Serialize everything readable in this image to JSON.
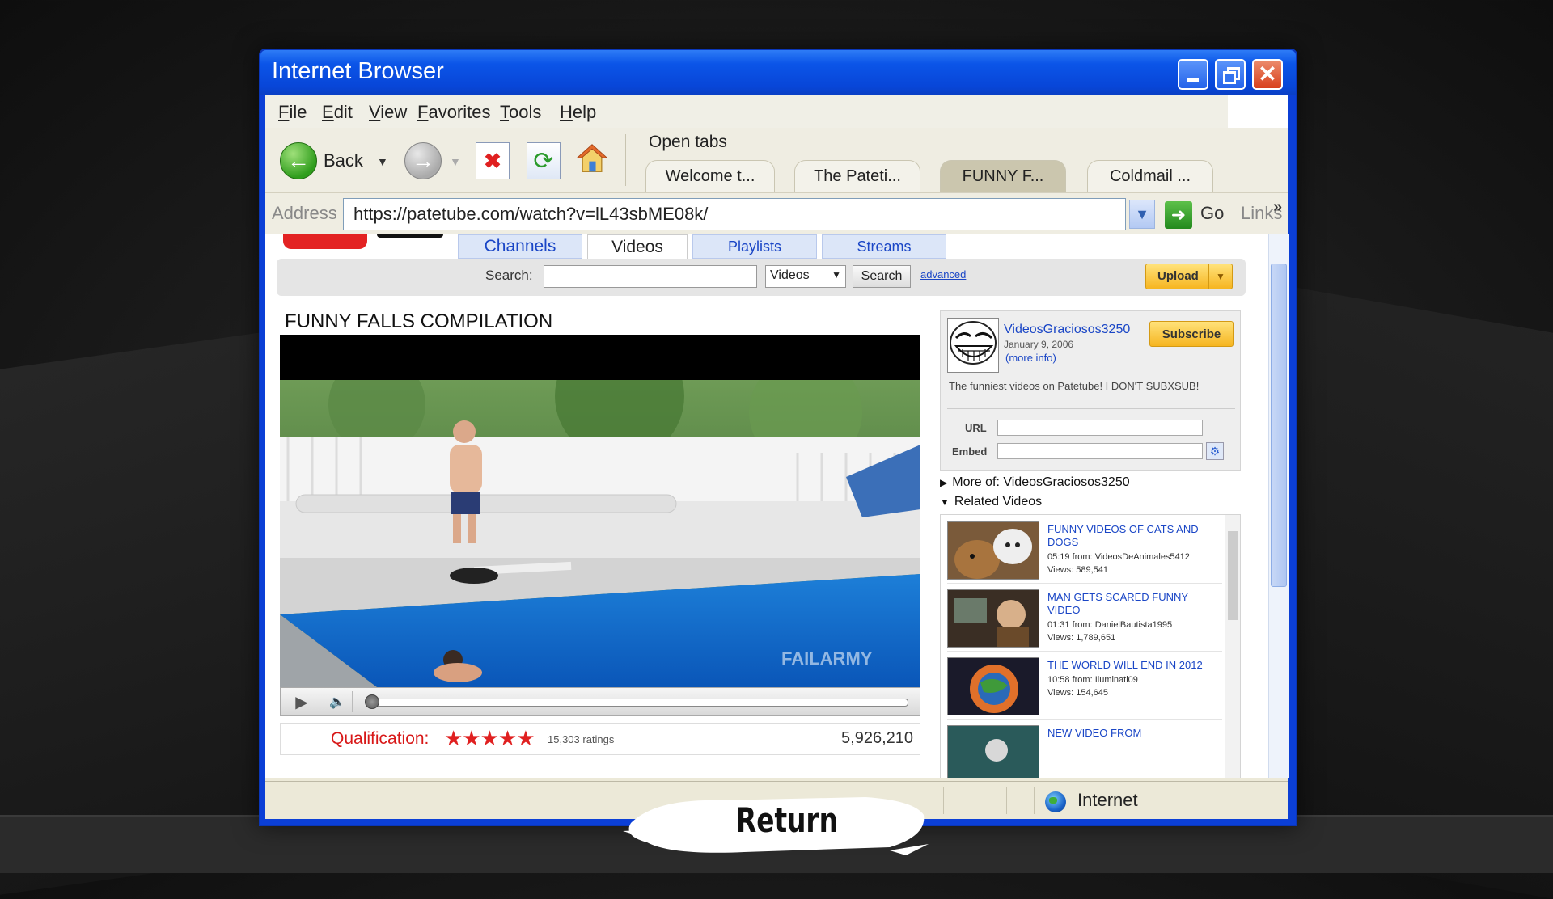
{
  "window": {
    "title": "Internet Browser"
  },
  "menu": [
    {
      "label": "File",
      "u": "F",
      "rest": "ile"
    },
    {
      "label": "Edit",
      "u": "E",
      "rest": "dit"
    },
    {
      "label": "View",
      "u": "V",
      "rest": "iew"
    },
    {
      "label": "Favorites",
      "u": "F",
      "rest": "avorites"
    },
    {
      "label": "Tools",
      "u": "T",
      "rest": "ools"
    },
    {
      "label": "Help",
      "u": "H",
      "rest": "elp"
    }
  ],
  "toolbar": {
    "back_label": "Back",
    "open_tabs_label": "Open tabs"
  },
  "tabs": [
    "Welcome t...",
    "The Pateti...",
    "FUNNY F...",
    "Coldmail ..."
  ],
  "active_tab_index": 2,
  "address": {
    "label": "Address",
    "url": "https://patetube.com/watch?v=lL43sbME08k/",
    "go_label": "Go",
    "links_label": "Links",
    "links_chevron": "»"
  },
  "site": {
    "nav": {
      "channels": "Channels",
      "videos": "Videos",
      "playlists": "Playlists",
      "streams": "Streams"
    },
    "search": {
      "label": "Search:",
      "select_value": "Videos",
      "button": "Search",
      "advanced": "advanced"
    },
    "upload_label": "Upload"
  },
  "video": {
    "title": "FUNNY FALLS COMPILATION",
    "watermark": "FAILARMY",
    "qualification_label": "Qualification:",
    "stars": "★★★★★",
    "ratings": "15,303 ratings",
    "views": "5,926,210",
    "progress": 0.0
  },
  "channel": {
    "name": "VideosGraciosos3250",
    "date": "January 9, 2006",
    "more_info": "(more info)",
    "subscribe": "Subscribe",
    "description": "The funniest videos on Patetube! I DON'T SUBXSUB!",
    "url_label": "URL",
    "embed_label": "Embed"
  },
  "sections": {
    "more_of": "More of: VideosGraciosos3250",
    "related": "Related Videos"
  },
  "related": [
    {
      "title": "FUNNY VIDEOS OF CATS AND DOGS",
      "meta1": "05:19 from: VideosDeAnimales5412",
      "meta2": "Views: 589,541"
    },
    {
      "title": "MAN GETS SCARED FUNNY VIDEO",
      "meta1": "01:31 from: DanielBautista1995",
      "meta2": "Views: 1,789,651"
    },
    {
      "title": "THE WORLD WILL END IN 2012",
      "meta1": "10:58 from: Iluminati09",
      "meta2": "Views: 154,645"
    },
    {
      "title": "NEW VIDEO FROM",
      "meta1": "",
      "meta2": ""
    }
  ],
  "status": {
    "zone": "Internet"
  },
  "overlay": {
    "return_label": "Return"
  },
  "icons": {
    "back": "left-arrow-icon",
    "forward": "right-arrow-icon",
    "stop": "stop-icon",
    "refresh": "refresh-icon",
    "home": "home-icon",
    "go": "go-arrow-icon",
    "zone": "globe-icon"
  }
}
